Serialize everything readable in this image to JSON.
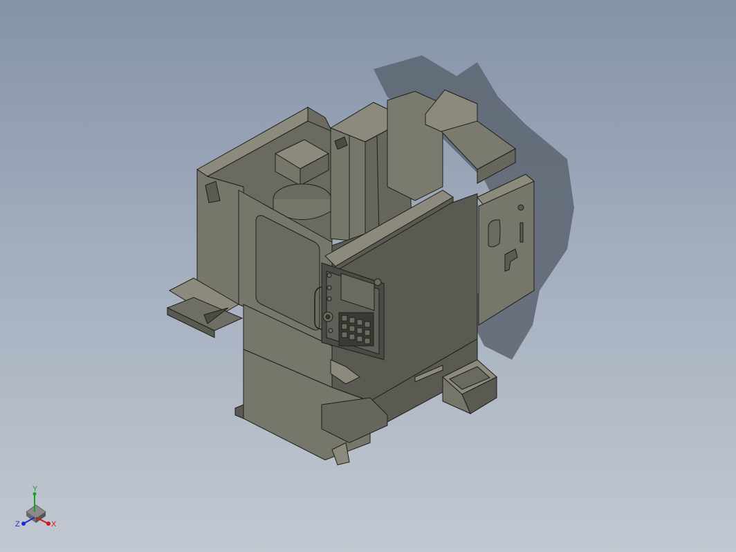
{
  "viewport": {
    "background_top": "#8593a8",
    "background_bottom": "#c2c8d1"
  },
  "model": {
    "shadow_color": "#5c6470",
    "edge_color": "#1e1e1a",
    "face_colors": {
      "light": "#8c8a7c",
      "mid": "#76766a",
      "dark": "#5a5a52",
      "darker": "#4b4b45"
    }
  },
  "triad": {
    "x_label": "X",
    "y_label": "Y",
    "z_label": "Z",
    "x_color": "#d01818",
    "y_color": "#18a018",
    "z_color": "#1830d0"
  }
}
